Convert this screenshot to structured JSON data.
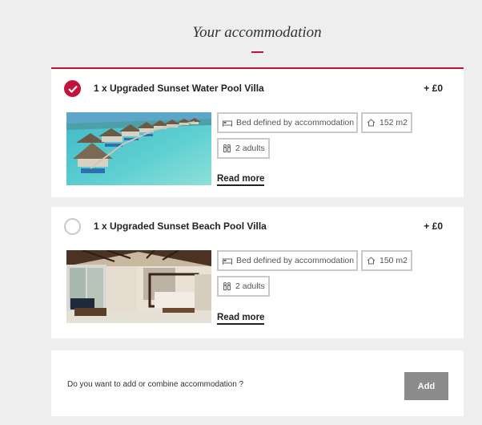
{
  "page": {
    "title": "Your accommodation"
  },
  "colors": {
    "accent": "#c0143c",
    "button_disabled": "#8c8c8c",
    "tag_border": "#c8c8c8"
  },
  "rooms": [
    {
      "selected": true,
      "name": "1 x Upgraded Sunset Water Pool Villa",
      "price": "+ £0",
      "photo": "overwater-villas-photo",
      "bed": "Bed defined by accommodation",
      "size": "152 m2",
      "guests": "2 adults",
      "read_more": "Read more"
    },
    {
      "selected": false,
      "name": "1 x Upgraded Sunset Beach Pool Villa",
      "price": "+ £0",
      "photo": "villa-bedroom-interior-photo",
      "bed": "Bed defined by accommodation",
      "size": "150 m2",
      "guests": "2 adults",
      "read_more": "Read more"
    }
  ],
  "add_section": {
    "question": "Do you want to add or combine accommodation ?",
    "button_label": "Add"
  }
}
